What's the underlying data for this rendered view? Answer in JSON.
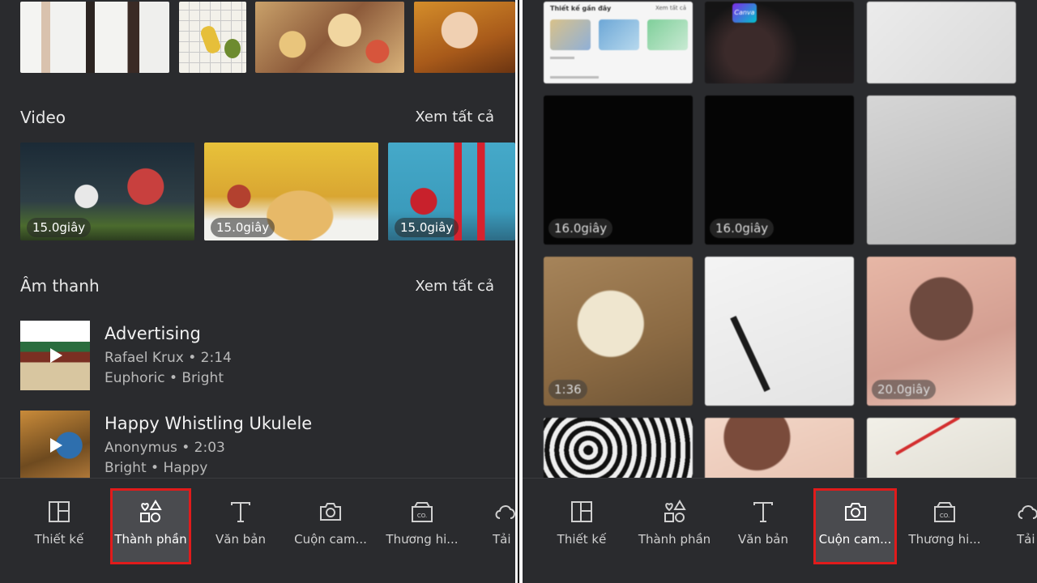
{
  "left": {
    "sections": {
      "video": {
        "title": "Video",
        "see_all": "Xem tất cả"
      },
      "audio": {
        "title": "Âm thanh",
        "see_all": "Xem tất cả"
      }
    },
    "videos": [
      {
        "duration": "15.0giây"
      },
      {
        "duration": "15.0giây"
      },
      {
        "duration": "15.0giây"
      }
    ],
    "tracks": [
      {
        "title": "Advertising",
        "artist_duration": "Rafael Krux • 2:14",
        "tags": "Euphoric • Bright"
      },
      {
        "title": "Happy Whistling Ukulele",
        "artist_duration": "Anonymus • 2:03",
        "tags": "Bright • Happy"
      }
    ],
    "nav": [
      {
        "label": "Thiết kế",
        "icon": "layout-icon"
      },
      {
        "label": "Thành phần",
        "icon": "elements-icon",
        "active": true
      },
      {
        "label": "Văn bản",
        "icon": "text-icon"
      },
      {
        "label": "Cuộn cam...",
        "icon": "camera-icon"
      },
      {
        "label": "Thương hi...",
        "icon": "brand-icon"
      },
      {
        "label": "Tải",
        "icon": "upload-icon"
      }
    ]
  },
  "right": {
    "doc_tile": {
      "heading": "Thiết kế gần đây",
      "see_all": "Xem tất cả"
    },
    "canva_badge": "Canva",
    "durations": [
      "16.0giây",
      "16.0giây",
      "1:36",
      "20.0giây"
    ],
    "nav": [
      {
        "label": "Thiết kế",
        "icon": "layout-icon"
      },
      {
        "label": "Thành phần",
        "icon": "elements-icon"
      },
      {
        "label": "Văn bản",
        "icon": "text-icon"
      },
      {
        "label": "Cuộn cam...",
        "icon": "camera-icon",
        "active": true
      },
      {
        "label": "Thương hi...",
        "icon": "brand-icon"
      },
      {
        "label": "Tải",
        "icon": "upload-icon"
      }
    ]
  },
  "colors": {
    "background": "#2a2b2e",
    "highlight": "#e11b1b",
    "active_tab_bg": "#4a4b4f"
  }
}
